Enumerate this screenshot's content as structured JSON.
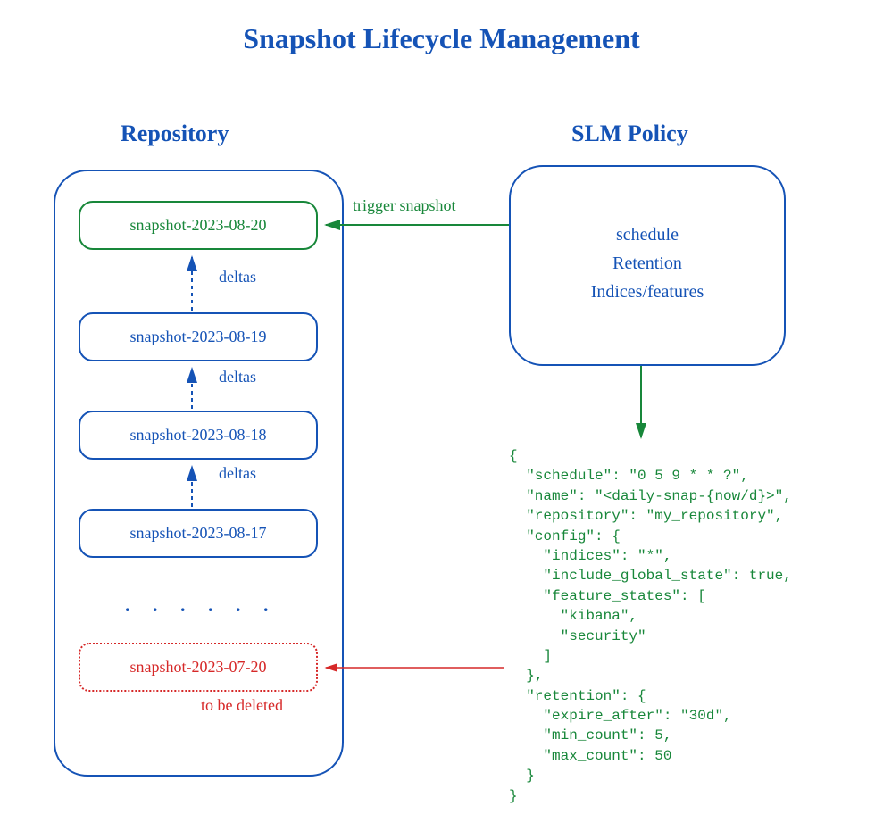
{
  "title": "Snapshot Lifecycle Management",
  "repository": {
    "label": "Repository",
    "snapshots": {
      "current": "snapshot-2023-08-20",
      "s2": "snapshot-2023-08-19",
      "s3": "snapshot-2023-08-18",
      "s4": "snapshot-2023-08-17",
      "expired": "snapshot-2023-07-20"
    },
    "delta_label": "deltas",
    "ellipsis": ". . . . . .",
    "to_delete_label": "to be deleted"
  },
  "slm": {
    "label": "SLM Policy",
    "body_line1": "schedule",
    "body_line2": "Retention",
    "body_line3": "Indices/features",
    "trigger_label": "trigger snapshot"
  },
  "policy_json": "{\n  \"schedule\": \"0 5 9 * * ?\",\n  \"name\": \"<daily-snap-{now/d}>\",\n  \"repository\": \"my_repository\",\n  \"config\": {\n    \"indices\": \"*\",\n    \"include_global_state\": true,\n    \"feature_states\": [\n      \"kibana\",\n      \"security\"\n    ]\n  },\n  \"retention\": {\n    \"expire_after\": \"30d\",\n    \"min_count\": 5,\n    \"max_count\": 50\n  }\n}",
  "colors": {
    "blue": "#1553b6",
    "green": "#18873a",
    "red": "#d62828"
  }
}
